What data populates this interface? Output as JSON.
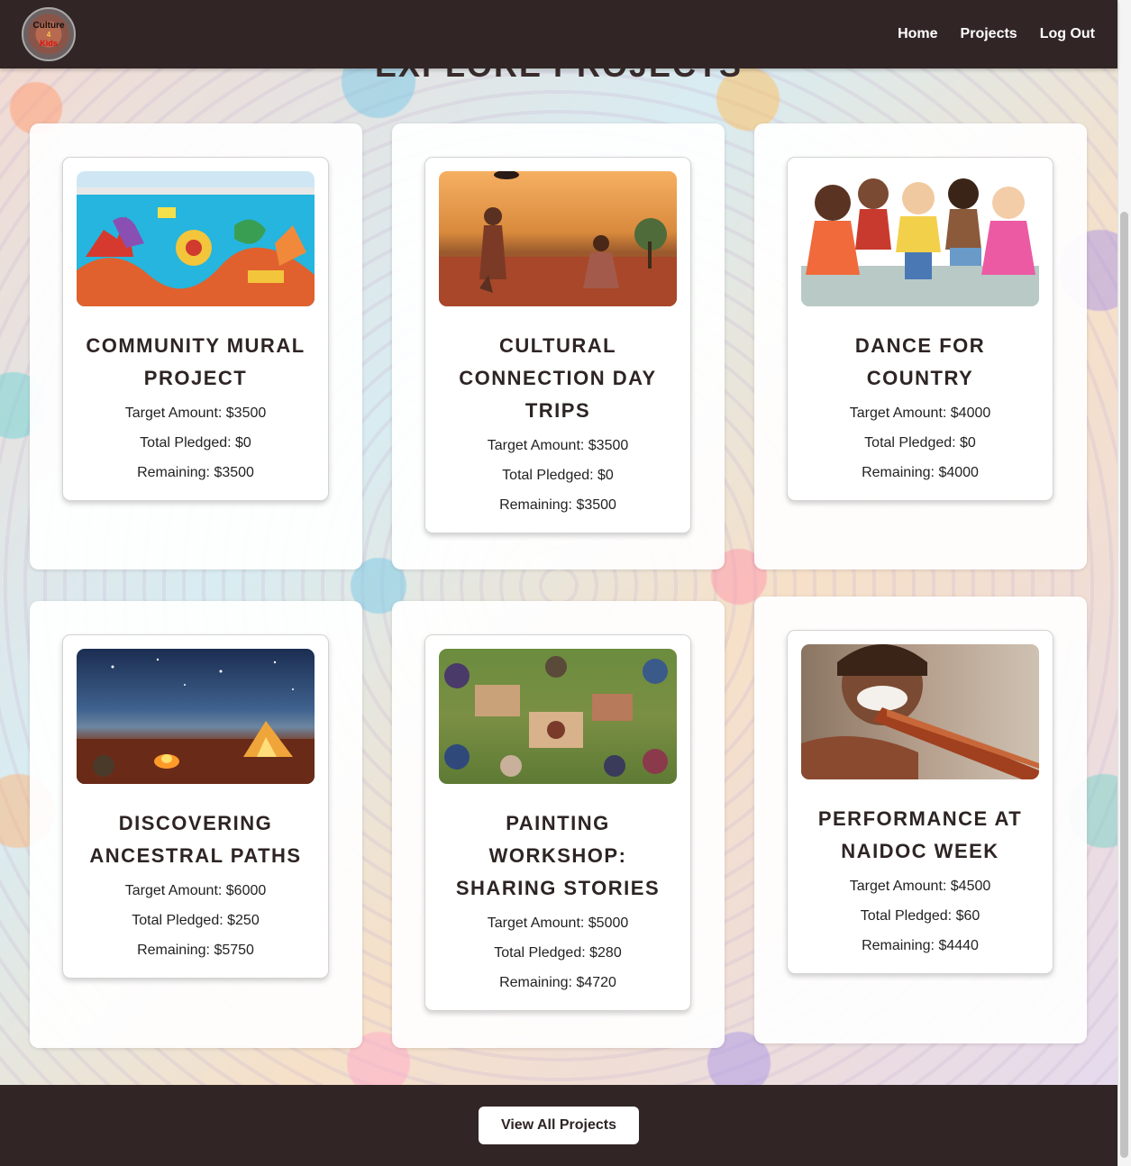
{
  "header": {
    "logo_line1": "Culture",
    "logo_line2": "4",
    "logo_line3": "Kids",
    "nav": [
      "Home",
      "Projects",
      "Log Out"
    ]
  },
  "page": {
    "heading": "EXPLORE PROJECTS"
  },
  "projects": [
    {
      "title": "COMMUNITY MURAL PROJECT",
      "target": "Target Amount: $3500",
      "pledged": "Total Pledged: $0",
      "remaining": "Remaining: $3500"
    },
    {
      "title": "CULTURAL CONNECTION DAY TRIPS",
      "target": "Target Amount: $3500",
      "pledged": "Total Pledged: $0",
      "remaining": "Remaining: $3500"
    },
    {
      "title": "DANCE FOR COUNTRY",
      "target": "Target Amount: $4000",
      "pledged": "Total Pledged: $0",
      "remaining": "Remaining: $4000"
    },
    {
      "title": "DISCOVERING ANCESTRAL PATHS",
      "target": "Target Amount: $6000",
      "pledged": "Total Pledged: $250",
      "remaining": "Remaining: $5750"
    },
    {
      "title": "PAINTING WORKSHOP: SHARING STORIES",
      "target": "Target Amount: $5000",
      "pledged": "Total Pledged: $280",
      "remaining": "Remaining: $4720"
    },
    {
      "title": "PERFORMANCE AT NAIDOC WEEK",
      "target": "Target Amount: $4500",
      "pledged": "Total Pledged: $60",
      "remaining": "Remaining: $4440"
    }
  ],
  "footer": {
    "button_label": "View All Projects"
  },
  "colors": {
    "header_bg": "#312525",
    "heading_text": "#2e2424",
    "card_bg": "#ffffff"
  }
}
